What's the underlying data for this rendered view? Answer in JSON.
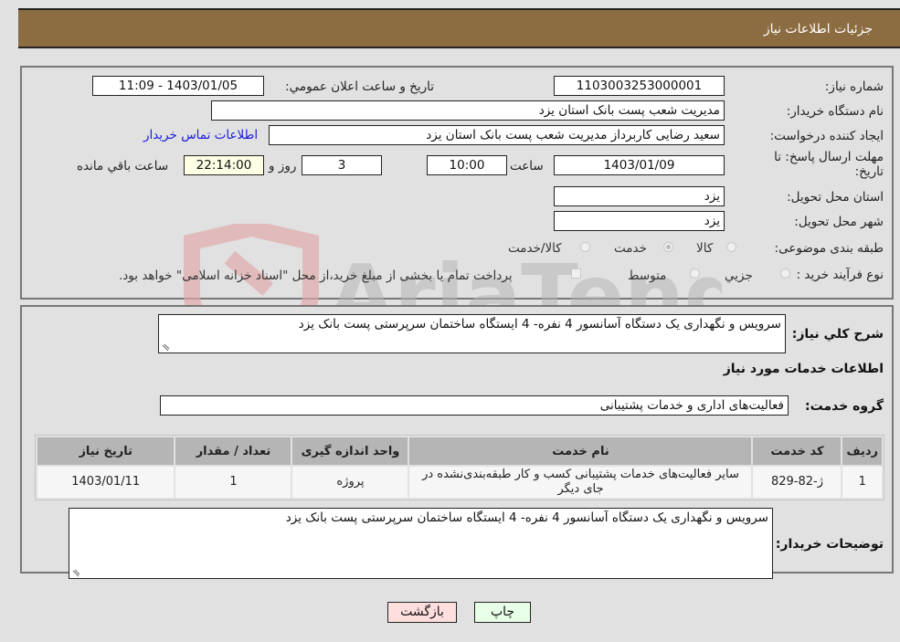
{
  "header": {
    "title": "جزئیات اطلاعات نیاز"
  },
  "fields": {
    "need_number": {
      "label": "شماره نیاز:",
      "value": "1103003253000001"
    },
    "announce_datetime": {
      "label": "تاریخ و ساعت اعلان عمومي:",
      "value": "1403/01/05 - 11:09"
    },
    "buyer_org": {
      "label": "نام دستگاه خریدار:",
      "value": "مدیریت شعب پست بانک استان یزد"
    },
    "requester": {
      "label": "ایجاد کننده درخواست:",
      "value": "سعید  رضایی کاربرداز مدیریت شعب پست بانک استان یزد"
    },
    "buyer_contact_link": "اطلاعات تماس خریدار",
    "deadline": {
      "label_line1": "مهلت ارسال پاسخ: تا",
      "label_line2": "تاریخ:",
      "date": "1403/01/09",
      "time_label": "ساعت",
      "time": "10:00",
      "days": "3",
      "days_label": "روز و",
      "remaining": "22:14:00",
      "remaining_label": "ساعت باقي مانده"
    },
    "delivery_province": {
      "label": "استان محل تحویل:",
      "value": "یزد"
    },
    "delivery_city": {
      "label": "شهر محل تحویل:",
      "value": "یزد"
    },
    "subject_category": {
      "label": "طبقه بندی موضوعی:",
      "options": [
        "کالا",
        "خدمت",
        "کالا/خدمت"
      ],
      "selected": "خدمت"
    },
    "purchase_process": {
      "label": "نوع فرآیند خرید :",
      "options": [
        "جزیي",
        "متوسط"
      ],
      "treasury_note": "پرداخت تمام یا بخشی از مبلغ خرید،از محل \"اسناد خزانه اسلامی\" خواهد بود."
    }
  },
  "general_description": {
    "label": "شرح کلي نیاز:",
    "value": "سرویس و نگهداری یک دستگاه آسانسور 4 نفره- 4 ایستگاه ساختمان سرپرستی پست بانک یزد"
  },
  "services_section": {
    "title": "اطلاعات خدمات مورد نیاز",
    "service_group_label": "گروه خدمت:",
    "service_group_value": "فعالیت‌های اداری و خدمات پشتیبانی",
    "table": {
      "headers": [
        "ردیف",
        "کد خدمت",
        "نام خدمت",
        "واحد اندازه گیری",
        "تعداد / مقدار",
        "تاریخ نیاز"
      ],
      "rows": [
        [
          "1",
          "ژ-82-829",
          "سایر فعالیت‌های خدمات پشتیبانی کسب و کار طبقه‌بندی‌نشده در جای دیگر",
          "پروژه",
          "1",
          "1403/01/11"
        ]
      ]
    }
  },
  "buyer_notes": {
    "label": "توضیحات خریدار:",
    "value": "سرویس و نگهداری یک دستگاه آسانسور 4 نفره- 4 ایستگاه ساختمان سرپرستی پست بانک یزد"
  },
  "buttons": {
    "print": "چاپ",
    "back": "بازگشت"
  },
  "colors": {
    "header_bg": "#8c6c41",
    "print_bg": "#e8ffe8",
    "back_bg": "#ffdede",
    "link": "#1a1adc"
  }
}
